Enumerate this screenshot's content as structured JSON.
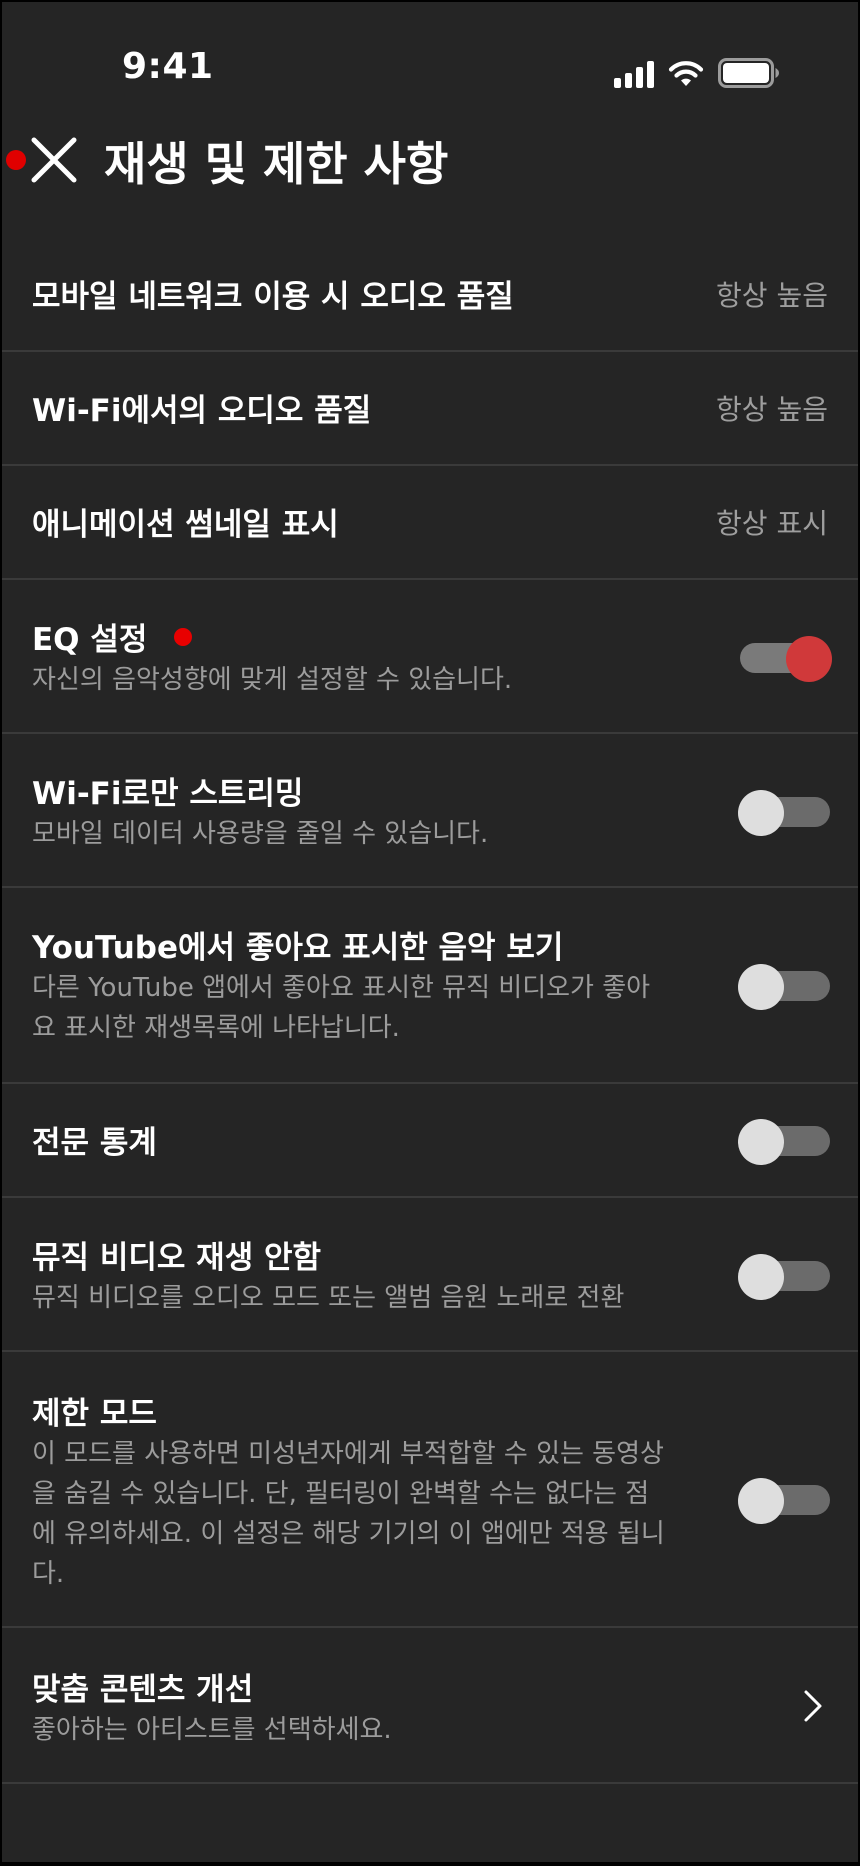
{
  "status_bar": {
    "time": "9:41",
    "icons": [
      "cellular-signal-icon",
      "wifi-icon",
      "battery-icon"
    ]
  },
  "header": {
    "title": "재생 및 제한 사항",
    "close_icon": "close-icon"
  },
  "settings": {
    "mobile_audio": {
      "title": "모바일 네트워크 이용 시 오디오 품질",
      "value": "항상 높음"
    },
    "wifi_audio": {
      "title": "Wi-Fi에서의 오디오 품질",
      "value": "항상 높음"
    },
    "animated_thumbnails": {
      "title": "애니메이션 썸네일 표시",
      "value": "항상 표시"
    },
    "eq": {
      "title": "EQ 설정",
      "description": "자신의 음악성향에 맞게 설정할 수 있습니다.",
      "enabled": true
    },
    "wifi_only": {
      "title": "Wi-Fi로만 스트리밍",
      "description": "모바일 데이터 사용량을 줄일 수 있습니다.",
      "enabled": false
    },
    "youtube_likes": {
      "title": "YouTube에서 좋아요 표시한 음악 보기",
      "description": "다른 YouTube 앱에서 좋아요 표시한 뮤직 비디오가 좋아요 표시한 재생목록에 나타납니다.",
      "enabled": false
    },
    "stats_for_nerds": {
      "title": "전문 통계",
      "enabled": false
    },
    "no_music_videos": {
      "title": "뮤직 비디오 재생 안함",
      "description": "뮤직 비디오를 오디오 모드 또는 앨범 음원 노래로 전환",
      "enabled": false
    },
    "restricted_mode": {
      "title": "제한 모드",
      "description": "이 모드를 사용하면 미성년자에게 부적합할 수 있는 동영상을 숨길 수 있습니다. 단, 필터링이 완벽할 수는 없다는 점에 유의하세요. 이 설정은 해당 기기의 이 앱에만 적용 됩니다.",
      "enabled": false
    },
    "improve_recommendations": {
      "title": "맞춤 콘텐츠 개선",
      "description": "좋아하는 아티스트를 선택하세요."
    }
  },
  "colors": {
    "background": "#252525",
    "divider": "#3a3a3a",
    "accent": "#d0393a",
    "indicator_dot": "#e00000",
    "secondary_text": "#9c9c9c"
  }
}
